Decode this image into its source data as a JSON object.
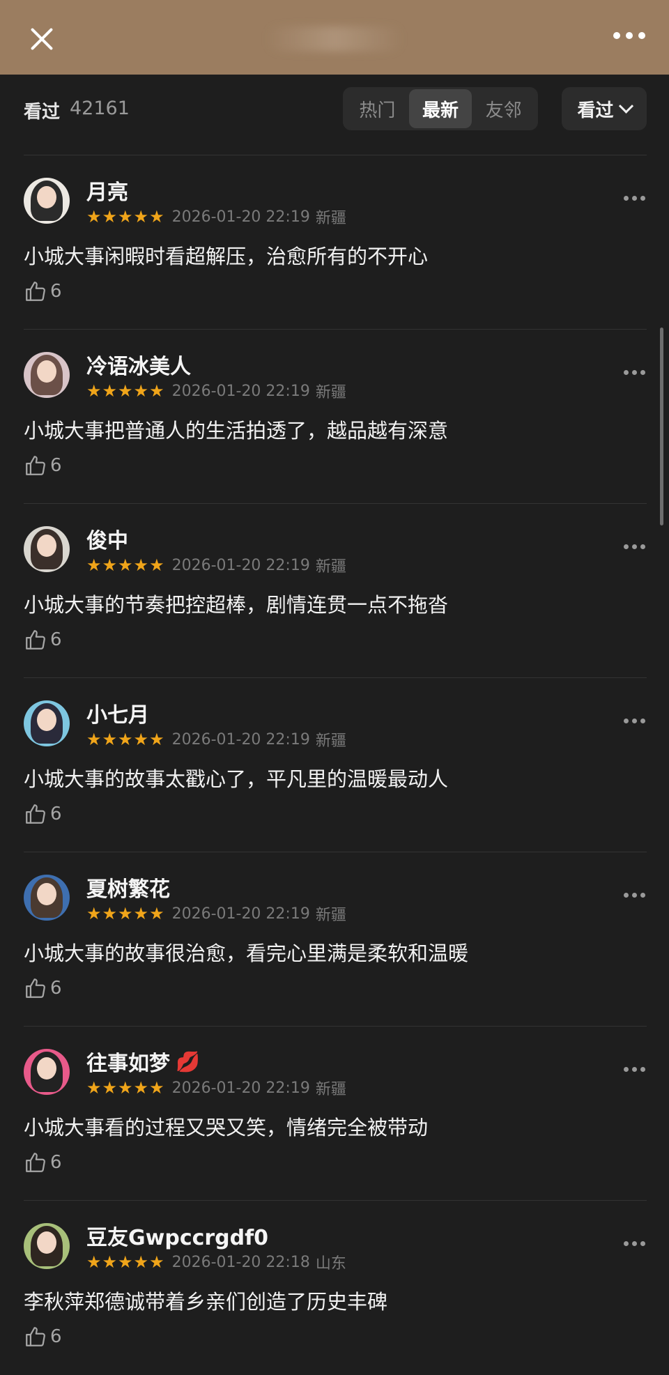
{
  "header": {
    "close_icon": "close-icon",
    "more_icon": "more-horizontal-icon",
    "background_color": "#9b7d60"
  },
  "filter": {
    "seen_label": "看过",
    "seen_count": "42161",
    "tabs": [
      {
        "label": "热门",
        "active": false
      },
      {
        "label": "最新",
        "active": true
      },
      {
        "label": "友邻",
        "active": false
      }
    ],
    "status_select": "看过"
  },
  "comments": [
    {
      "username": "月亮",
      "stars": "★★★★★",
      "timestamp": "2026-01-20 22:19",
      "location": "新疆",
      "text": "小城大事闲暇时看超解压，治愈所有的不开心",
      "likes": "6"
    },
    {
      "username": "冷语冰美人",
      "stars": "★★★★★",
      "timestamp": "2026-01-20 22:19",
      "location": "新疆",
      "text": "小城大事把普通人的生活拍透了，越品越有深意",
      "likes": "6"
    },
    {
      "username": "俊中",
      "stars": "★★★★★",
      "timestamp": "2026-01-20 22:19",
      "location": "新疆",
      "text": "小城大事的节奏把控超棒，剧情连贯一点不拖沓",
      "likes": "6"
    },
    {
      "username": "小七月",
      "stars": "★★★★★",
      "timestamp": "2026-01-20 22:19",
      "location": "新疆",
      "text": "小城大事的故事太戳心了，平凡里的温暖最动人",
      "likes": "6"
    },
    {
      "username": "夏树繁花",
      "stars": "★★★★★",
      "timestamp": "2026-01-20 22:19",
      "location": "新疆",
      "text": "小城大事的故事很治愈，看完心里满是柔软和温暖",
      "likes": "6"
    },
    {
      "username": "往事如梦",
      "emoji": "💋",
      "stars": "★★★★★",
      "timestamp": "2026-01-20 22:19",
      "location": "新疆",
      "text": "小城大事看的过程又哭又笑，情绪完全被带动",
      "likes": "6"
    },
    {
      "username": "豆友Gwpccrgdf0",
      "stars": "★★★★★",
      "timestamp": "2026-01-20 22:18",
      "location": "山东",
      "text": "李秋萍郑德诚带着乡亲们创造了历史丰碑",
      "likes": "6"
    }
  ],
  "colors": {
    "star": "#f0a51a",
    "background": "#1e1e1e"
  }
}
